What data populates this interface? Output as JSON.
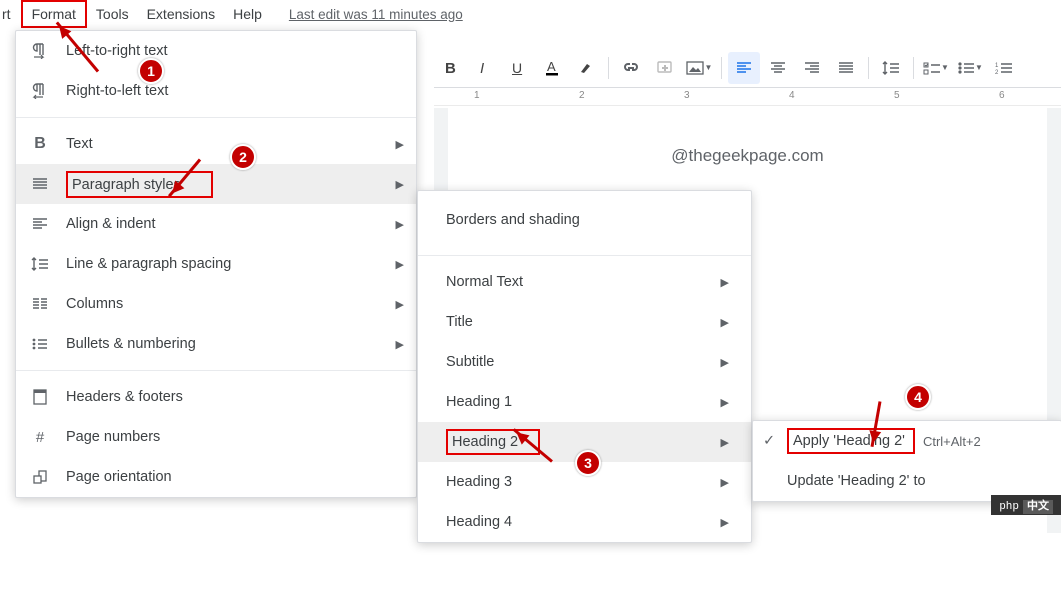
{
  "menubar": {
    "partial": "rt",
    "format": "Format",
    "tools": "Tools",
    "extensions": "Extensions",
    "help": "Help",
    "last_edit": "Last edit was 11 minutes ago"
  },
  "format_menu": {
    "ltr": "Left-to-right text",
    "rtl": "Right-to-left text",
    "text": "Text",
    "paragraph_styles": "Paragraph styles",
    "align_indent": "Align & indent",
    "line_spacing": "Line & paragraph spacing",
    "columns": "Columns",
    "bullets_numbering": "Bullets & numbering",
    "headers_footers": "Headers & footers",
    "page_numbers": "Page numbers",
    "page_orientation": "Page orientation"
  },
  "para_submenu": {
    "borders_shading": "Borders and shading",
    "normal_text": "Normal Text",
    "title": "Title",
    "subtitle": "Subtitle",
    "heading1": "Heading 1",
    "heading2": "Heading 2",
    "heading3": "Heading 3",
    "heading4": "Heading 4"
  },
  "heading_submenu": {
    "apply": "Apply 'Heading 2'",
    "update": "Update 'Heading 2' to",
    "shortcut": "Ctrl+Alt+2"
  },
  "doc": {
    "watermark": "@thegeekpage.com"
  },
  "ruler": {
    "n1": "1",
    "n2": "2",
    "n3": "3",
    "n4": "4",
    "n5": "5",
    "n6": "6"
  },
  "annotations": {
    "b1": "1",
    "b2": "2",
    "b3": "3",
    "b4": "4"
  },
  "footer": {
    "php": "php"
  }
}
